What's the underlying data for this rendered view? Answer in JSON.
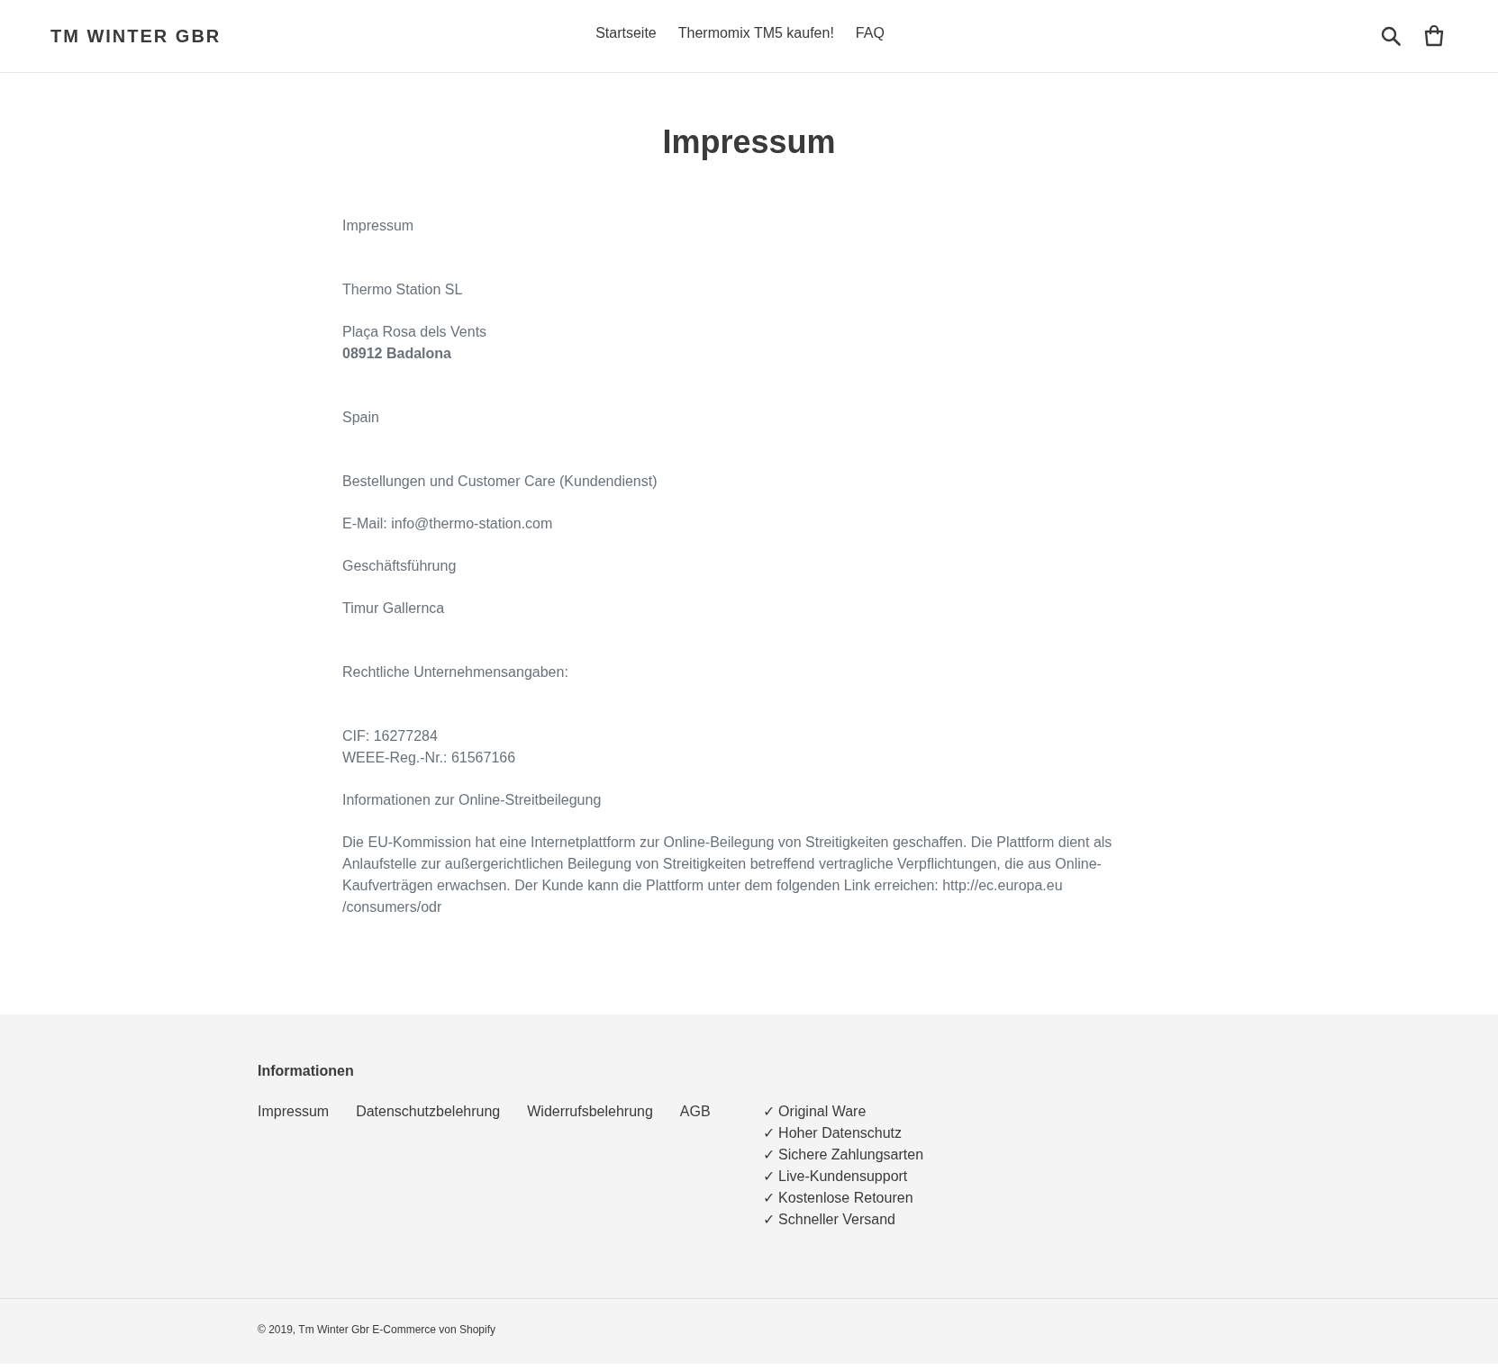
{
  "header": {
    "logo": "TM WINTER GBR",
    "nav": [
      "Startseite",
      "Thermomix TM5 kaufen!",
      "FAQ"
    ]
  },
  "page": {
    "title": "Impressum",
    "paragraphs": [
      {
        "lines": [
          "Impressum"
        ]
      },
      {
        "lines": [
          "Thermo Station SL"
        ]
      },
      {
        "lines": [
          "Plaça Rosa dels Vents",
          "**08912 Badalona**"
        ]
      },
      {
        "lines": [
          "Spain"
        ]
      },
      {
        "lines": [
          "Bestellungen und Customer Care (Kundendienst)"
        ]
      },
      {
        "lines": [
          "E-Mail: info@thermo-station.com"
        ]
      },
      {
        "lines": [
          "Geschäftsführung"
        ]
      },
      {
        "lines": [
          "Timur Gallernca"
        ]
      },
      {
        "lines": [
          "Rechtliche Unternehmensangaben:"
        ]
      },
      {
        "lines": [
          "CIF: 16277284",
          "WEEE-Reg.-Nr.: 61567166"
        ]
      },
      {
        "lines": [
          "Informationen zur Online-Streitbeilegung"
        ]
      },
      {
        "lines": [
          "Die EU-Kommission hat eine Internetplattform zur Online-Beilegung von Streitigkeiten geschaffen. Die Plattform dient als Anlaufstelle zur außergerichtlichen Beilegung von Streitigkeiten betreffend vertragliche Verpflichtungen, die aus Online-Kaufverträgen erwachsen. Der Kunde kann die Plattform unter dem folgenden Link erreichen: http://ec.europa.eu /consumers/odr"
        ]
      }
    ]
  },
  "footer": {
    "heading": "Informationen",
    "links": [
      "Impressum",
      "Datenschutzbelehrung",
      "Widerrufsbelehrung",
      "AGB"
    ],
    "features": [
      "✓ Original Ware",
      "✓ Hoher Datenschutz",
      "✓ Sichere Zahlungsarten",
      "✓ Live-Kundensupport",
      "✓ Kostenlose Retouren",
      "✓ Schneller Versand"
    ],
    "copyright": "© 2019, Tm Winter Gbr E-Commerce von Shopify"
  }
}
